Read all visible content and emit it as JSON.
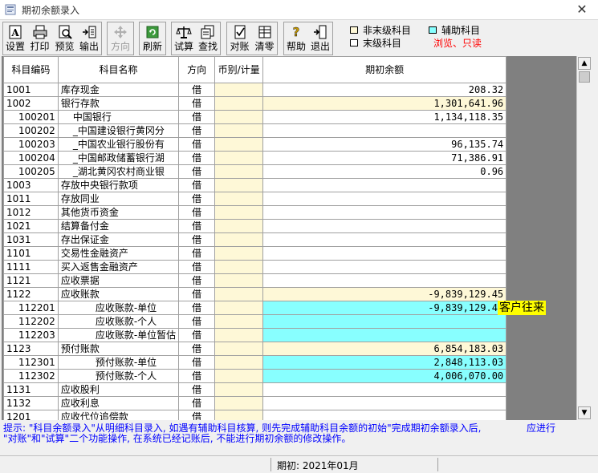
{
  "window": {
    "title": "期初余额录入",
    "close_glyph": "✕"
  },
  "toolbar": {
    "groups": [
      {
        "buttons": [
          {
            "label": "设置",
            "icon": "settings-a-icon",
            "enabled": true
          },
          {
            "label": "打印",
            "icon": "printer-icon",
            "enabled": true
          },
          {
            "label": "预览",
            "icon": "preview-icon",
            "enabled": true
          },
          {
            "label": "输出",
            "icon": "export-icon",
            "enabled": true
          }
        ]
      },
      {
        "buttons": [
          {
            "label": "方向",
            "icon": "direction-icon",
            "enabled": false
          }
        ]
      },
      {
        "buttons": [
          {
            "label": "刷新",
            "icon": "refresh-icon",
            "enabled": true
          }
        ]
      },
      {
        "buttons": [
          {
            "label": "试算",
            "icon": "balance-scale-icon",
            "enabled": true
          },
          {
            "label": "查找",
            "icon": "find-icon",
            "enabled": true
          }
        ]
      },
      {
        "buttons": [
          {
            "label": "对账",
            "icon": "check-ledger-icon",
            "enabled": true
          },
          {
            "label": "清零",
            "icon": "clear-icon",
            "enabled": true
          }
        ]
      },
      {
        "buttons": [
          {
            "label": "帮助",
            "icon": "help-icon",
            "enabled": true
          },
          {
            "label": "退出",
            "icon": "exit-icon",
            "enabled": true
          }
        ]
      }
    ]
  },
  "legend": {
    "items": [
      {
        "label": "非末级科目",
        "color": "#fef8d7"
      },
      {
        "label": "辅助科目",
        "color": "#88ffff"
      },
      {
        "label": "末级科目",
        "color": "#ffffff"
      }
    ],
    "readonly_label": "浏览、只读",
    "readonly_color": "#ff0000"
  },
  "grid": {
    "headers": [
      "科目编码",
      "科目名称",
      "方向",
      "币别/计量",
      "期初余额"
    ],
    "rows": [
      {
        "code": "1001",
        "name": "库存现金",
        "indent": 0,
        "dir": "借",
        "amount": "208.32",
        "amount_bg": "white"
      },
      {
        "code": "1002",
        "name": "银行存款",
        "indent": 0,
        "dir": "借",
        "amount": "1,301,641.96",
        "amount_bg": "yellow"
      },
      {
        "code": "100201",
        "name": "中国银行",
        "indent": 1,
        "dir": "借",
        "amount": "1,134,118.35",
        "amount_bg": "white"
      },
      {
        "code": "100202",
        "name": "_中国建设银行黄冈分",
        "indent": 1,
        "dir": "借",
        "amount": "",
        "amount_bg": "white"
      },
      {
        "code": "100203",
        "name": "_中国农业银行股份有",
        "indent": 1,
        "dir": "借",
        "amount": "96,135.74",
        "amount_bg": "white"
      },
      {
        "code": "100204",
        "name": "_中国邮政储蓄银行湖",
        "indent": 1,
        "dir": "借",
        "amount": "71,386.91",
        "amount_bg": "white"
      },
      {
        "code": "100205",
        "name": "_湖北黄冈农村商业银",
        "indent": 1,
        "dir": "借",
        "amount": "0.96",
        "amount_bg": "white"
      },
      {
        "code": "1003",
        "name": "存放中央银行款项",
        "indent": 0,
        "dir": "借",
        "amount": "",
        "amount_bg": "white"
      },
      {
        "code": "1011",
        "name": "存放同业",
        "indent": 0,
        "dir": "借",
        "amount": "",
        "amount_bg": "white"
      },
      {
        "code": "1012",
        "name": "其他货币资金",
        "indent": 0,
        "dir": "借",
        "amount": "",
        "amount_bg": "white"
      },
      {
        "code": "1021",
        "name": "结算备付金",
        "indent": 0,
        "dir": "借",
        "amount": "",
        "amount_bg": "white"
      },
      {
        "code": "1031",
        "name": "存出保证金",
        "indent": 0,
        "dir": "借",
        "amount": "",
        "amount_bg": "white"
      },
      {
        "code": "1101",
        "name": "交易性金融资产",
        "indent": 0,
        "dir": "借",
        "amount": "",
        "amount_bg": "white"
      },
      {
        "code": "1111",
        "name": "买入返售金融资产",
        "indent": 0,
        "dir": "借",
        "amount": "",
        "amount_bg": "white"
      },
      {
        "code": "1121",
        "name": "应收票据",
        "indent": 0,
        "dir": "借",
        "amount": "",
        "amount_bg": "white"
      },
      {
        "code": "1122",
        "name": "应收账款",
        "indent": 0,
        "dir": "借",
        "amount": "-9,839,129.45",
        "amount_bg": "yellow"
      },
      {
        "code": "112201",
        "name": "应收账款-单位",
        "indent": 2,
        "dir": "借",
        "amount": "-9,839,129.45",
        "amount_bg": "cyan"
      },
      {
        "code": "112202",
        "name": "应收账款-个人",
        "indent": 2,
        "dir": "借",
        "amount": "",
        "amount_bg": "cyan"
      },
      {
        "code": "112203",
        "name": "应收账款-单位暂估",
        "indent": 2,
        "dir": "借",
        "amount": "",
        "amount_bg": "cyan"
      },
      {
        "code": "1123",
        "name": "预付账款",
        "indent": 0,
        "dir": "借",
        "amount": "6,854,183.03",
        "amount_bg": "yellow"
      },
      {
        "code": "112301",
        "name": "预付账款-单位",
        "indent": 2,
        "dir": "借",
        "amount": "2,848,113.03",
        "amount_bg": "cyan"
      },
      {
        "code": "112302",
        "name": "预付账款-个人",
        "indent": 2,
        "dir": "借",
        "amount": "4,006,070.00",
        "amount_bg": "cyan"
      },
      {
        "code": "1131",
        "name": "应收股利",
        "indent": 0,
        "dir": "借",
        "amount": "",
        "amount_bg": "white"
      },
      {
        "code": "1132",
        "name": "应收利息",
        "indent": 0,
        "dir": "借",
        "amount": "",
        "amount_bg": "white"
      },
      {
        "code": "1201",
        "name": "应收代位追偿款",
        "indent": 0,
        "dir": "借",
        "amount": "",
        "amount_bg": "white"
      }
    ]
  },
  "customer_label": "客户往来",
  "hint": {
    "line1": "提示: \"科目余额录入\"从明细科目录入, 如遇有辅助科目核算, 则先完成辅助科目余额的初始\"完成期初余额录入后,",
    "line1_tail": "应进行",
    "line2": "\"对账\"和\"试算\"二个功能操作, 在系统已经记账后, 不能进行期初余额的修改操作。"
  },
  "status": {
    "period": "期初: 2021年01月"
  }
}
